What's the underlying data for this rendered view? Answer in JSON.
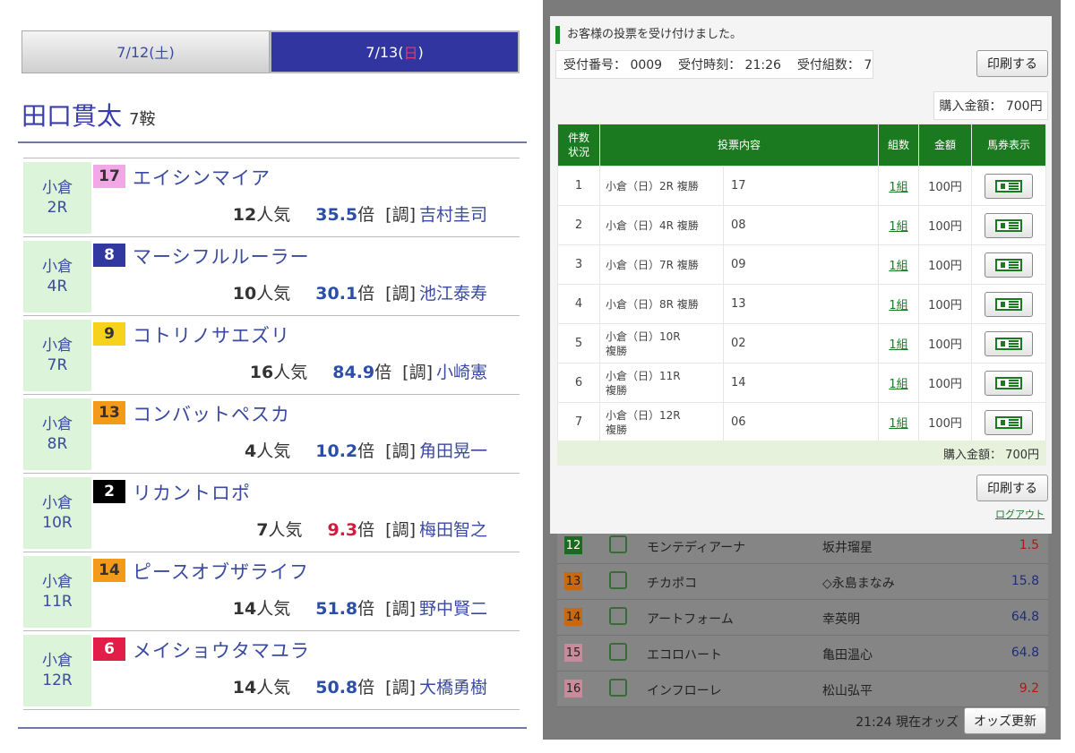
{
  "left": {
    "tabs": [
      {
        "label_pre": "7/12(",
        "label_day": "土",
        "label_post": ")"
      },
      {
        "label_pre": "7/13(",
        "label_day": "日",
        "label_post": ")"
      }
    ],
    "jockey": {
      "name": "田口貫太",
      "rides": "7鞍"
    },
    "rows": [
      {
        "place": "小倉",
        "race": "2R",
        "num": "17",
        "badge_bg": "#f2a8e6",
        "badge_fg": "#333333",
        "horse": "エイシンマイア",
        "pop_num": "12",
        "pop_unit": "人気",
        "odds_num": "35.5",
        "odds_unit": "倍",
        "trainer_tag": "[調]",
        "trainer": "吉村圭司",
        "odds_color": "blue"
      },
      {
        "place": "小倉",
        "race": "4R",
        "num": "8",
        "badge_bg": "#3139a0",
        "badge_fg": "#ffffff",
        "horse": "マーシフルルーラー",
        "pop_num": "10",
        "pop_unit": "人気",
        "odds_num": "30.1",
        "odds_unit": "倍",
        "trainer_tag": "[調]",
        "trainer": "池江泰寿",
        "odds_color": "blue"
      },
      {
        "place": "小倉",
        "race": "7R",
        "num": "9",
        "badge_bg": "#f7d21a",
        "badge_fg": "#333333",
        "horse": "コトリノサエズリ",
        "pop_num": "16",
        "pop_unit": "人気",
        "odds_num": "84.9",
        "odds_unit": "倍",
        "trainer_tag": "[調]",
        "trainer": "小崎憲",
        "odds_color": "blue"
      },
      {
        "place": "小倉",
        "race": "8R",
        "num": "13",
        "badge_bg": "#f39a1a",
        "badge_fg": "#333333",
        "horse": "コンバットペスカ",
        "pop_num": "4",
        "pop_unit": "人気",
        "odds_num": "10.2",
        "odds_unit": "倍",
        "trainer_tag": "[調]",
        "trainer": "角田晃一",
        "odds_color": "blue"
      },
      {
        "place": "小倉",
        "race": "10R",
        "num": "2",
        "badge_bg": "#000000",
        "badge_fg": "#ffffff",
        "horse": "リカントロポ",
        "pop_num": "7",
        "pop_unit": "人気",
        "odds_num": "9.3",
        "odds_unit": "倍",
        "trainer_tag": "[調]",
        "trainer": "梅田智之",
        "odds_color": "red"
      },
      {
        "place": "小倉",
        "race": "11R",
        "num": "14",
        "badge_bg": "#f39a1a",
        "badge_fg": "#333333",
        "horse": "ピースオブザライフ",
        "pop_num": "14",
        "pop_unit": "人気",
        "odds_num": "51.8",
        "odds_unit": "倍",
        "trainer_tag": "[調]",
        "trainer": "野中賢二",
        "odds_color": "blue"
      },
      {
        "place": "小倉",
        "race": "12R",
        "num": "6",
        "badge_bg": "#e11d48",
        "badge_fg": "#ffffff",
        "horse": "メイショウタマユラ",
        "pop_num": "14",
        "pop_unit": "人気",
        "odds_num": "50.8",
        "odds_unit": "倍",
        "trainer_tag": "[調]",
        "trainer": "大橋勇樹",
        "odds_color": "blue"
      }
    ]
  },
  "right": {
    "notice": "お客様の投票を受け付けました。",
    "receipt": {
      "no": "受付番号： 0009",
      "time": "受付時刻： 21:26",
      "count": "受付組数： 7"
    },
    "print_label": "印刷する",
    "purchase_amount": "購入金額： 700円",
    "headers": {
      "status": "件数\n状況",
      "content": "投票内容",
      "kumi": "組数",
      "amount": "金額",
      "ticket": "馬券表示"
    },
    "bets": [
      {
        "no": "1",
        "race": "小倉（日）2R 複勝",
        "sel": "17",
        "kumi": "1組",
        "amount": "100円"
      },
      {
        "no": "2",
        "race": "小倉（日）4R 複勝",
        "sel": "08",
        "kumi": "1組",
        "amount": "100円"
      },
      {
        "no": "3",
        "race": "小倉（日）7R 複勝",
        "sel": "09",
        "kumi": "1組",
        "amount": "100円"
      },
      {
        "no": "4",
        "race": "小倉（日）8R 複勝",
        "sel": "13",
        "kumi": "1組",
        "amount": "100円"
      },
      {
        "no": "5",
        "race": "小倉（日）10R\n複勝",
        "sel": "02",
        "kumi": "1組",
        "amount": "100円"
      },
      {
        "no": "6",
        "race": "小倉（日）11R\n複勝",
        "sel": "14",
        "kumi": "1組",
        "amount": "100円"
      },
      {
        "no": "7",
        "race": "小倉（日）12R\n複勝",
        "sel": "06",
        "kumi": "1組",
        "amount": "100円"
      }
    ],
    "total": "購入金額： 700円",
    "logout": "ログアウト",
    "odds_rows": [
      {
        "num": "12",
        "num_bg": "#1b6b1f",
        "num_fg": "#ffffff",
        "name": "モンテディアーナ",
        "jockey": "坂井瑠星",
        "odds": "1.5",
        "odds_color": "#b01818"
      },
      {
        "num": "13",
        "num_bg": "#c56a12",
        "num_fg": "#222222",
        "name": "チカポコ",
        "jockey": "◇永島まなみ",
        "odds": "15.8",
        "odds_color": "#1e2f7a"
      },
      {
        "num": "14",
        "num_bg": "#c56a12",
        "num_fg": "#222222",
        "name": "アートフォーム",
        "jockey": "幸英明",
        "odds": "64.8",
        "odds_color": "#1e2f7a"
      },
      {
        "num": "15",
        "num_bg": "#c98a9c",
        "num_fg": "#222222",
        "name": "エコロハート",
        "jockey": "亀田温心",
        "odds": "64.8",
        "odds_color": "#1e2f7a"
      },
      {
        "num": "16",
        "num_bg": "#c98a9c",
        "num_fg": "#222222",
        "name": "インフローレ",
        "jockey": "松山弘平",
        "odds": "9.2",
        "odds_color": "#b01818"
      }
    ],
    "update_time": "21:24 現在オッズ",
    "update_button": "オッズ更新"
  }
}
